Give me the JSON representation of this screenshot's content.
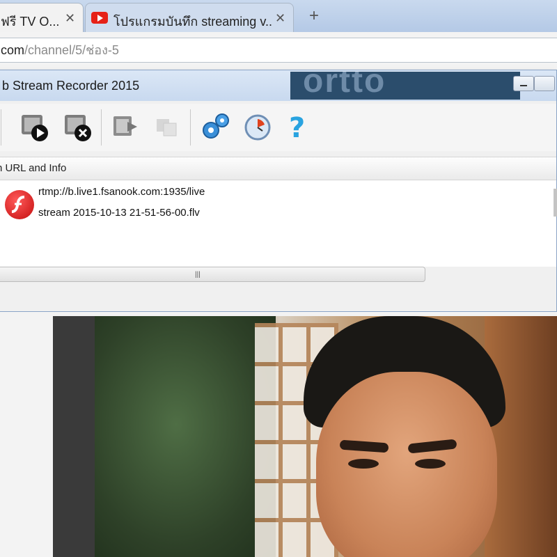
{
  "browser": {
    "tabs": [
      {
        "title": "ฟรี TV O..."
      },
      {
        "title": "โปรแกรมบันทึก streaming v..."
      }
    ],
    "address": {
      "host": "com",
      "path": "/channel/5/ช่อง-5"
    }
  },
  "recorder": {
    "title": "b Stream Recorder 2015",
    "header": "n URL and Info",
    "items": [
      {
        "url": "rtmp://b.live1.fsanook.com:1935/live",
        "file": "stream 2015-10-13 21-51-56-00.flv"
      }
    ]
  },
  "icons": {
    "play": "record-play-icon",
    "stop": "record-stop-icon",
    "export": "export-icon",
    "copy": "copy-icon-disabled",
    "settings": "gears-icon",
    "schedule": "clock-icon",
    "help": "question-mark-icon",
    "file": "flash-icon"
  },
  "colors": {
    "tab_bar": "#c9d9ee",
    "recorder_title_bar": "#dbe7f6",
    "youtube_red": "#e62117",
    "flash_red": "#d31919",
    "gear_blue": "#3a8fd8",
    "help_blue": "#29a3e0"
  }
}
